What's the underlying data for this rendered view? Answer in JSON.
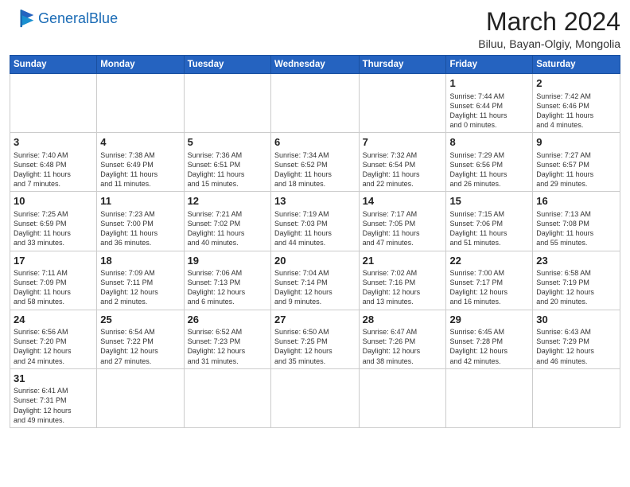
{
  "header": {
    "logo_general": "General",
    "logo_blue": "Blue",
    "month_year": "March 2024",
    "location": "Biluu, Bayan-Olgiy, Mongolia"
  },
  "weekdays": [
    "Sunday",
    "Monday",
    "Tuesday",
    "Wednesday",
    "Thursday",
    "Friday",
    "Saturday"
  ],
  "weeks": [
    [
      {
        "day": "",
        "info": ""
      },
      {
        "day": "",
        "info": ""
      },
      {
        "day": "",
        "info": ""
      },
      {
        "day": "",
        "info": ""
      },
      {
        "day": "",
        "info": ""
      },
      {
        "day": "1",
        "info": "Sunrise: 7:44 AM\nSunset: 6:44 PM\nDaylight: 11 hours\nand 0 minutes."
      },
      {
        "day": "2",
        "info": "Sunrise: 7:42 AM\nSunset: 6:46 PM\nDaylight: 11 hours\nand 4 minutes."
      }
    ],
    [
      {
        "day": "3",
        "info": "Sunrise: 7:40 AM\nSunset: 6:48 PM\nDaylight: 11 hours\nand 7 minutes."
      },
      {
        "day": "4",
        "info": "Sunrise: 7:38 AM\nSunset: 6:49 PM\nDaylight: 11 hours\nand 11 minutes."
      },
      {
        "day": "5",
        "info": "Sunrise: 7:36 AM\nSunset: 6:51 PM\nDaylight: 11 hours\nand 15 minutes."
      },
      {
        "day": "6",
        "info": "Sunrise: 7:34 AM\nSunset: 6:52 PM\nDaylight: 11 hours\nand 18 minutes."
      },
      {
        "day": "7",
        "info": "Sunrise: 7:32 AM\nSunset: 6:54 PM\nDaylight: 11 hours\nand 22 minutes."
      },
      {
        "day": "8",
        "info": "Sunrise: 7:29 AM\nSunset: 6:56 PM\nDaylight: 11 hours\nand 26 minutes."
      },
      {
        "day": "9",
        "info": "Sunrise: 7:27 AM\nSunset: 6:57 PM\nDaylight: 11 hours\nand 29 minutes."
      }
    ],
    [
      {
        "day": "10",
        "info": "Sunrise: 7:25 AM\nSunset: 6:59 PM\nDaylight: 11 hours\nand 33 minutes."
      },
      {
        "day": "11",
        "info": "Sunrise: 7:23 AM\nSunset: 7:00 PM\nDaylight: 11 hours\nand 36 minutes."
      },
      {
        "day": "12",
        "info": "Sunrise: 7:21 AM\nSunset: 7:02 PM\nDaylight: 11 hours\nand 40 minutes."
      },
      {
        "day": "13",
        "info": "Sunrise: 7:19 AM\nSunset: 7:03 PM\nDaylight: 11 hours\nand 44 minutes."
      },
      {
        "day": "14",
        "info": "Sunrise: 7:17 AM\nSunset: 7:05 PM\nDaylight: 11 hours\nand 47 minutes."
      },
      {
        "day": "15",
        "info": "Sunrise: 7:15 AM\nSunset: 7:06 PM\nDaylight: 11 hours\nand 51 minutes."
      },
      {
        "day": "16",
        "info": "Sunrise: 7:13 AM\nSunset: 7:08 PM\nDaylight: 11 hours\nand 55 minutes."
      }
    ],
    [
      {
        "day": "17",
        "info": "Sunrise: 7:11 AM\nSunset: 7:09 PM\nDaylight: 11 hours\nand 58 minutes."
      },
      {
        "day": "18",
        "info": "Sunrise: 7:09 AM\nSunset: 7:11 PM\nDaylight: 12 hours\nand 2 minutes."
      },
      {
        "day": "19",
        "info": "Sunrise: 7:06 AM\nSunset: 7:13 PM\nDaylight: 12 hours\nand 6 minutes."
      },
      {
        "day": "20",
        "info": "Sunrise: 7:04 AM\nSunset: 7:14 PM\nDaylight: 12 hours\nand 9 minutes."
      },
      {
        "day": "21",
        "info": "Sunrise: 7:02 AM\nSunset: 7:16 PM\nDaylight: 12 hours\nand 13 minutes."
      },
      {
        "day": "22",
        "info": "Sunrise: 7:00 AM\nSunset: 7:17 PM\nDaylight: 12 hours\nand 16 minutes."
      },
      {
        "day": "23",
        "info": "Sunrise: 6:58 AM\nSunset: 7:19 PM\nDaylight: 12 hours\nand 20 minutes."
      }
    ],
    [
      {
        "day": "24",
        "info": "Sunrise: 6:56 AM\nSunset: 7:20 PM\nDaylight: 12 hours\nand 24 minutes."
      },
      {
        "day": "25",
        "info": "Sunrise: 6:54 AM\nSunset: 7:22 PM\nDaylight: 12 hours\nand 27 minutes."
      },
      {
        "day": "26",
        "info": "Sunrise: 6:52 AM\nSunset: 7:23 PM\nDaylight: 12 hours\nand 31 minutes."
      },
      {
        "day": "27",
        "info": "Sunrise: 6:50 AM\nSunset: 7:25 PM\nDaylight: 12 hours\nand 35 minutes."
      },
      {
        "day": "28",
        "info": "Sunrise: 6:47 AM\nSunset: 7:26 PM\nDaylight: 12 hours\nand 38 minutes."
      },
      {
        "day": "29",
        "info": "Sunrise: 6:45 AM\nSunset: 7:28 PM\nDaylight: 12 hours\nand 42 minutes."
      },
      {
        "day": "30",
        "info": "Sunrise: 6:43 AM\nSunset: 7:29 PM\nDaylight: 12 hours\nand 46 minutes."
      }
    ],
    [
      {
        "day": "31",
        "info": "Sunrise: 6:41 AM\nSunset: 7:31 PM\nDaylight: 12 hours\nand 49 minutes."
      },
      {
        "day": "",
        "info": ""
      },
      {
        "day": "",
        "info": ""
      },
      {
        "day": "",
        "info": ""
      },
      {
        "day": "",
        "info": ""
      },
      {
        "day": "",
        "info": ""
      },
      {
        "day": "",
        "info": ""
      }
    ]
  ]
}
